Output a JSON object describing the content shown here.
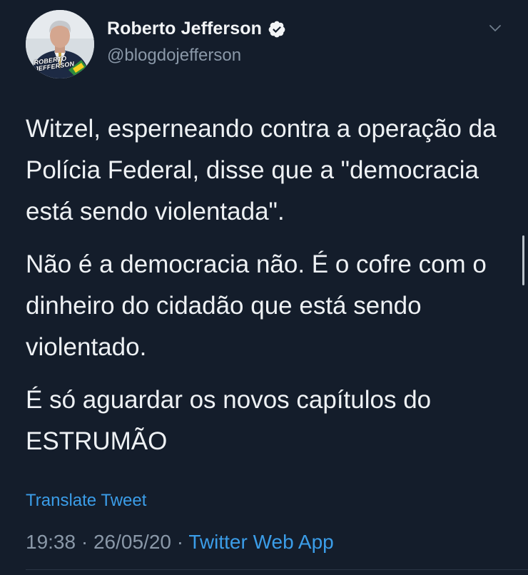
{
  "tweet": {
    "avatar_text_line1": "ROBERTO",
    "avatar_text_line2": "JEFFERSON",
    "display_name": "Roberto Jefferson",
    "handle": "@blogdojefferson",
    "paragraphs": [
      "Witzel, esperneando contra a operação da Polícia Federal, disse que a \"democracia está sendo violentada\".",
      "Não é a democracia não. É o cofre com o dinheiro do cidadão que está sendo violentado.",
      "É só aguardar os novos capítulos do ESTRUMÃO"
    ],
    "translate_label": "Translate Tweet",
    "time": "19:38",
    "date": "26/05/20",
    "separator": "·",
    "source_app": "Twitter Web App"
  },
  "icons": {
    "verified": "verified-badge-icon",
    "caret": "chevron-down-icon"
  },
  "colors": {
    "background": "#141d2b",
    "link": "#3b9de8",
    "secondary_text": "#8a98a8"
  }
}
